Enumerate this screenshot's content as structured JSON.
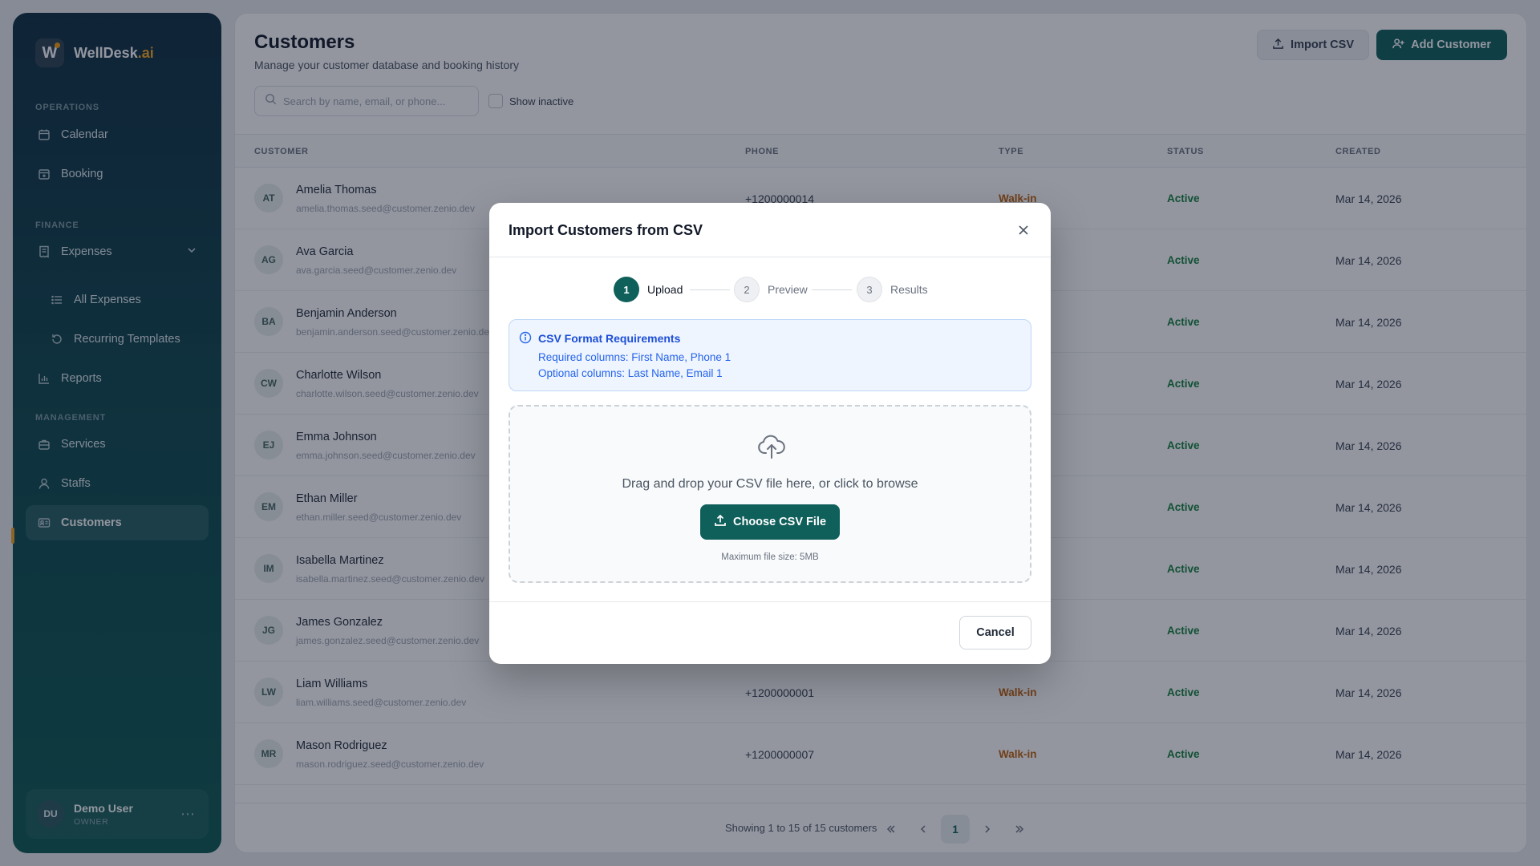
{
  "brand": {
    "name": "WellDesk",
    "suffix": ".ai",
    "mark": "W"
  },
  "sidebar": {
    "sections": {
      "operations": "OPERATIONS",
      "finance": "FINANCE",
      "management": "MANAGEMENT"
    },
    "items": {
      "calendar": "Calendar",
      "booking": "Booking",
      "expenses": "Expenses",
      "all_expenses": "All Expenses",
      "recurring_templates": "Recurring Templates",
      "reports": "Reports",
      "services": "Services",
      "staffs": "Staffs",
      "customers": "Customers"
    },
    "user": {
      "initials": "DU",
      "name": "Demo User",
      "role": "OWNER"
    }
  },
  "page": {
    "title": "Customers",
    "subtitle": "Manage your customer database and booking history",
    "import_label": "Import CSV",
    "add_label": "Add Customer",
    "search_placeholder": "Search by name, email, or phone...",
    "show_inactive": "Show inactive"
  },
  "table": {
    "columns": {
      "customer": "CUSTOMER",
      "phone": "PHONE",
      "type": "TYPE",
      "status": "STATUS",
      "created": "CREATED"
    },
    "rows": [
      {
        "initials": "AT",
        "name": "Amelia Thomas",
        "email": "amelia.thomas.seed@customer.zenio.dev",
        "phone": "+1200000014",
        "type": "Walk-in",
        "status": "Active",
        "created": "Mar 14, 2026"
      },
      {
        "initials": "AG",
        "name": "Ava Garcia",
        "email": "ava.garcia.seed@customer.zenio.dev",
        "phone": "",
        "type": "",
        "status": "Active",
        "created": "Mar 14, 2026"
      },
      {
        "initials": "BA",
        "name": "Benjamin Anderson",
        "email": "benjamin.anderson.seed@customer.zenio.dev",
        "phone": "",
        "type": "",
        "status": "Active",
        "created": "Mar 14, 2026"
      },
      {
        "initials": "CW",
        "name": "Charlotte Wilson",
        "email": "charlotte.wilson.seed@customer.zenio.dev",
        "phone": "",
        "type": "",
        "status": "Active",
        "created": "Mar 14, 2026"
      },
      {
        "initials": "EJ",
        "name": "Emma Johnson",
        "email": "emma.johnson.seed@customer.zenio.dev",
        "phone": "",
        "type": "",
        "status": "Active",
        "created": "Mar 14, 2026"
      },
      {
        "initials": "EM",
        "name": "Ethan Miller",
        "email": "ethan.miller.seed@customer.zenio.dev",
        "phone": "",
        "type": "",
        "status": "Active",
        "created": "Mar 14, 2026"
      },
      {
        "initials": "IM",
        "name": "Isabella Martinez",
        "email": "isabella.martinez.seed@customer.zenio.dev",
        "phone": "",
        "type": "",
        "status": "Active",
        "created": "Mar 14, 2026"
      },
      {
        "initials": "JG",
        "name": "James Gonzalez",
        "email": "james.gonzalez.seed@customer.zenio.dev",
        "phone": "",
        "type": "",
        "status": "Active",
        "created": "Mar 14, 2026"
      },
      {
        "initials": "LW",
        "name": "Liam Williams",
        "email": "liam.williams.seed@customer.zenio.dev",
        "phone": "+1200000001",
        "type": "Walk-in",
        "status": "Active",
        "created": "Mar 14, 2026"
      },
      {
        "initials": "MR",
        "name": "Mason Rodriguez",
        "email": "mason.rodriguez.seed@customer.zenio.dev",
        "phone": "+1200000007",
        "type": "Walk-in",
        "status": "Active",
        "created": "Mar 14, 2026"
      }
    ]
  },
  "pagination": {
    "showing": "Showing 1 to 15 of 15 customers",
    "current": "1"
  },
  "modal": {
    "title": "Import Customers from CSV",
    "steps": [
      {
        "number": "1",
        "label": "Upload"
      },
      {
        "number": "2",
        "label": "Preview"
      },
      {
        "number": "3",
        "label": "Results"
      }
    ],
    "info": {
      "title": "CSV Format Requirements",
      "required": "Required columns: First Name, Phone 1",
      "optional": "Optional columns: Last Name, Email 1"
    },
    "dropzone": {
      "text": "Drag and drop your CSV file here, or click to browse",
      "button": "Choose CSV File",
      "max_size": "Maximum file size: 5MB"
    },
    "cancel": "Cancel"
  },
  "colors": {
    "accent": "#0f5f5b",
    "brand_highlight": "#f5a623",
    "active_status": "#15803d",
    "walkin": "#c2610c",
    "info": "#1d4ed8"
  }
}
